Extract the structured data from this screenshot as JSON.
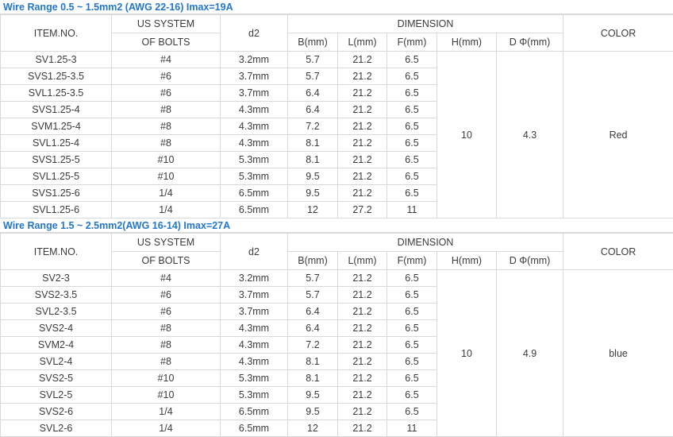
{
  "tables": [
    {
      "title": "Wire Range 0.5 ~ 1.5mm2 (AWG 22-16) Imax=19A",
      "headers": {
        "item_no": "ITEM.NO.",
        "bolts_line1": "US SYSTEM",
        "bolts_line2": "OF BOLTS",
        "d2": "d2",
        "dimension": "DIMENSION",
        "b": "B(mm)",
        "l": "L(mm)",
        "f": "F(mm)",
        "h": "H(mm)",
        "d_phi": "D Φ(mm)",
        "color": "COLOR"
      },
      "merged": {
        "h": "10",
        "d_phi": "4.3",
        "color": "Red"
      },
      "rows": [
        {
          "item_no": "SV1.25-3",
          "bolts": "#4",
          "d2": "3.2mm",
          "b": "5.7",
          "l": "21.2",
          "f": "6.5"
        },
        {
          "item_no": "SVS1.25-3.5",
          "bolts": "#6",
          "d2": "3.7mm",
          "b": "5.7",
          "l": "21.2",
          "f": "6.5"
        },
        {
          "item_no": "SVL1.25-3.5",
          "bolts": "#6",
          "d2": "3.7mm",
          "b": "6.4",
          "l": "21.2",
          "f": "6.5"
        },
        {
          "item_no": "SVS1.25-4",
          "bolts": "#8",
          "d2": "4.3mm",
          "b": "6.4",
          "l": "21.2",
          "f": "6.5"
        },
        {
          "item_no": "SVM1.25-4",
          "bolts": "#8",
          "d2": "4.3mm",
          "b": "7.2",
          "l": "21.2",
          "f": "6.5"
        },
        {
          "item_no": "SVL1.25-4",
          "bolts": "#8",
          "d2": "4.3mm",
          "b": "8.1",
          "l": "21.2",
          "f": "6.5"
        },
        {
          "item_no": "SVS1.25-5",
          "bolts": "#10",
          "d2": "5.3mm",
          "b": "8.1",
          "l": "21.2",
          "f": "6.5"
        },
        {
          "item_no": "SVL1.25-5",
          "bolts": "#10",
          "d2": "5.3mm",
          "b": "9.5",
          "l": "21.2",
          "f": "6.5"
        },
        {
          "item_no": "SVS1.25-6",
          "bolts": "1/4",
          "d2": "6.5mm",
          "b": "9.5",
          "l": "21.2",
          "f": "6.5"
        },
        {
          "item_no": "SVL1.25-6",
          "bolts": "1/4",
          "d2": "6.5mm",
          "b": "12",
          "l": "27.2",
          "f": "11"
        }
      ]
    },
    {
      "title": "Wire Range 1.5 ~ 2.5mm2(AWG 16-14) Imax=27A",
      "headers": {
        "item_no": "ITEM.NO.",
        "bolts_line1": "US SYSTEM",
        "bolts_line2": "OF BOLTS",
        "d2": "d2",
        "dimension": "DIMENSION",
        "b": "B(mm)",
        "l": "L(mm)",
        "f": "F(mm)",
        "h": "H(mm)",
        "d_phi": "D Φ(mm)",
        "color": "COLOR"
      },
      "merged": {
        "h": "10",
        "d_phi": "4.9",
        "color": "blue"
      },
      "rows": [
        {
          "item_no": "SV2-3",
          "bolts": "#4",
          "d2": "3.2mm",
          "b": "5.7",
          "l": "21.2",
          "f": "6.5"
        },
        {
          "item_no": "SVS2-3.5",
          "bolts": "#6",
          "d2": "3.7mm",
          "b": "5.7",
          "l": "21.2",
          "f": "6.5"
        },
        {
          "item_no": "SVL2-3.5",
          "bolts": "#6",
          "d2": "3.7mm",
          "b": "6.4",
          "l": "21.2",
          "f": "6.5"
        },
        {
          "item_no": "SVS2-4",
          "bolts": "#8",
          "d2": "4.3mm",
          "b": "6.4",
          "l": "21.2",
          "f": "6.5"
        },
        {
          "item_no": "SVM2-4",
          "bolts": "#8",
          "d2": "4.3mm",
          "b": "7.2",
          "l": "21.2",
          "f": "6.5"
        },
        {
          "item_no": "SVL2-4",
          "bolts": "#8",
          "d2": "4.3mm",
          "b": "8.1",
          "l": "21.2",
          "f": "6.5"
        },
        {
          "item_no": "SVS2-5",
          "bolts": "#10",
          "d2": "5.3mm",
          "b": "8.1",
          "l": "21.2",
          "f": "6.5"
        },
        {
          "item_no": "SVL2-5",
          "bolts": "#10",
          "d2": "5.3mm",
          "b": "9.5",
          "l": "21.2",
          "f": "6.5"
        },
        {
          "item_no": "SVS2-6",
          "bolts": "1/4",
          "d2": "6.5mm",
          "b": "9.5",
          "l": "21.2",
          "f": "6.5"
        },
        {
          "item_no": "SVL2-6",
          "bolts": "1/4",
          "d2": "6.5mm",
          "b": "12",
          "l": "21.2",
          "f": "11"
        }
      ]
    }
  ],
  "colors": {
    "title_text": "#2277cc",
    "grid_line": "#d9d9d9",
    "body_text": "#3b3b3b"
  }
}
